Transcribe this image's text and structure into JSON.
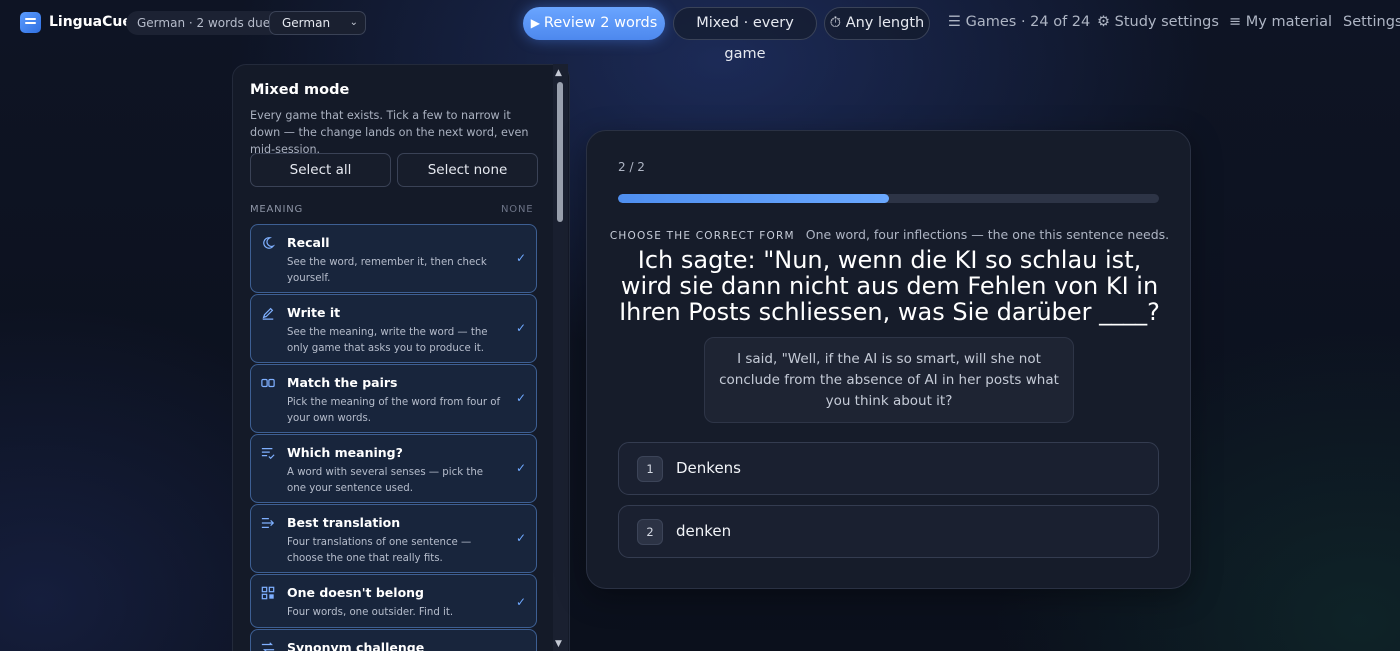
{
  "header": {
    "brand": "LinguaCue",
    "due_pill": "German · 2 words due",
    "language_select": "German",
    "review_button": "Review 2 words",
    "mode_button": "Mixed · every game",
    "length_button": "Any length",
    "nav": {
      "games": "Games · 24 of 24",
      "study_settings": "Study settings",
      "my_material": "My material",
      "settings": "Settings"
    },
    "icons": {
      "play": "▶",
      "timer": "⏱",
      "games": "☰",
      "study_settings": "⚙",
      "my_material": "≡"
    }
  },
  "panel": {
    "title": "Mixed mode",
    "description": "Every game that exists. Tick a few to narrow it down — the change lands on the next word, even mid-session.",
    "select_all": "Select all",
    "select_none": "Select none",
    "section_label": "MEANING",
    "section_action": "NONE",
    "games": [
      {
        "name": "Recall",
        "desc": "See the word, remember it, then check yourself.",
        "icon": "moon-icon",
        "checked": true
      },
      {
        "name": "Write it",
        "desc": "See the meaning, write the word — the only game that asks you to produce it.",
        "icon": "pencil-icon",
        "checked": true
      },
      {
        "name": "Match the pairs",
        "desc": "Pick the meaning of the word from four of your own words.",
        "icon": "pairs-icon",
        "checked": true
      },
      {
        "name": "Which meaning?",
        "desc": "A word with several senses — pick the one your sentence used.",
        "icon": "list-check-icon",
        "checked": true
      },
      {
        "name": "Best translation",
        "desc": "Four translations of one sentence — choose the one that really fits.",
        "icon": "list-arrow-icon",
        "checked": true
      },
      {
        "name": "One doesn't belong",
        "desc": "Four words, one outsider. Find it.",
        "icon": "grid-icon",
        "checked": true
      },
      {
        "name": "Synonym challenge",
        "desc": "",
        "icon": "swap-icon",
        "checked": true
      }
    ],
    "check_glyph": "✓"
  },
  "card": {
    "counter": "2 / 2",
    "progress_fraction": 0.5,
    "prompt_tag": "CHOOSE THE CORRECT FORM",
    "prompt_hint": "One word, four inflections — the one this sentence needs.",
    "sentence": "Ich sagte: \"Nun, wenn die KI so schlau ist, wird sie dann nicht aus dem Fehlen von KI in Ihren Posts schliessen, was Sie darüber ____?",
    "translation": "I said, \"Well, if the AI is so smart, will she not conclude from the absence of AI in her posts what you think about it?",
    "options": [
      {
        "key": "1",
        "text": "Denkens"
      },
      {
        "key": "2",
        "text": "denken"
      }
    ]
  },
  "colors": {
    "accent": "#5b97f5",
    "card_border_selected": "#3d5f93",
    "background": "#0d1220"
  }
}
